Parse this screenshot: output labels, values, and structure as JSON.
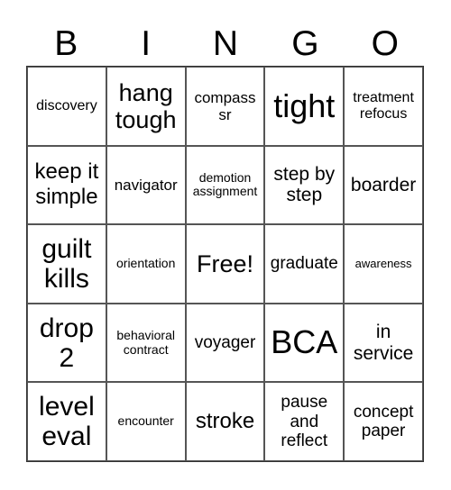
{
  "header": [
    "B",
    "I",
    "N",
    "G",
    "O"
  ],
  "cells": [
    [
      "discovery",
      "hang tough",
      "compass sr",
      "tight",
      "treatment refocus"
    ],
    [
      "keep it simple",
      "navigator",
      "demotion assignment",
      "step by step",
      "boarder"
    ],
    [
      "guilt kills",
      "orientation",
      "Free!",
      "graduate",
      "awareness"
    ],
    [
      "drop 2",
      "behavioral contract",
      "voyager",
      "BCA",
      "in service"
    ],
    [
      "level eval",
      "encounter",
      "stroke",
      "pause and reflect",
      "concept paper"
    ]
  ]
}
